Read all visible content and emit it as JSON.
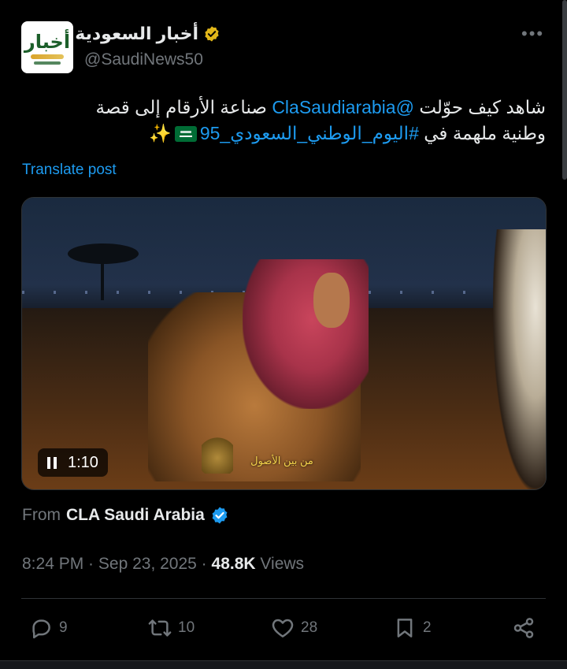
{
  "account": {
    "name": "أخبار السعودية",
    "handle": "@SaudiNews50",
    "logo_text": "أخبار"
  },
  "post": {
    "text_line1_pre": "شاهد كيف حوّلت ",
    "mention": "@ClaSaudiarabia",
    "text_line1_post": " صناعة الأرقام إلى قصة",
    "text_line2_pre": "وطنية ملهمة في ",
    "hashtag": "#اليوم_الوطني_السعودي_95",
    "sparkle": "✨"
  },
  "translate_label": "Translate post",
  "video": {
    "duration": "1:10",
    "subtitle": "من بين الأصول",
    "state": "playing"
  },
  "source": {
    "prefix": "From",
    "name": "CLA Saudi Arabia"
  },
  "meta": {
    "time": "8:24 PM",
    "sep1": " · ",
    "date": "Sep 23, 2025",
    "sep2": " · ",
    "views_count": "48.8K",
    "views_label": " Views"
  },
  "actions": {
    "replies": "9",
    "reposts": "10",
    "likes": "28",
    "bookmarks": "2"
  },
  "colors": {
    "accent": "#1d9bf0",
    "verified_gold": "#e2b719",
    "muted": "#71767b"
  }
}
